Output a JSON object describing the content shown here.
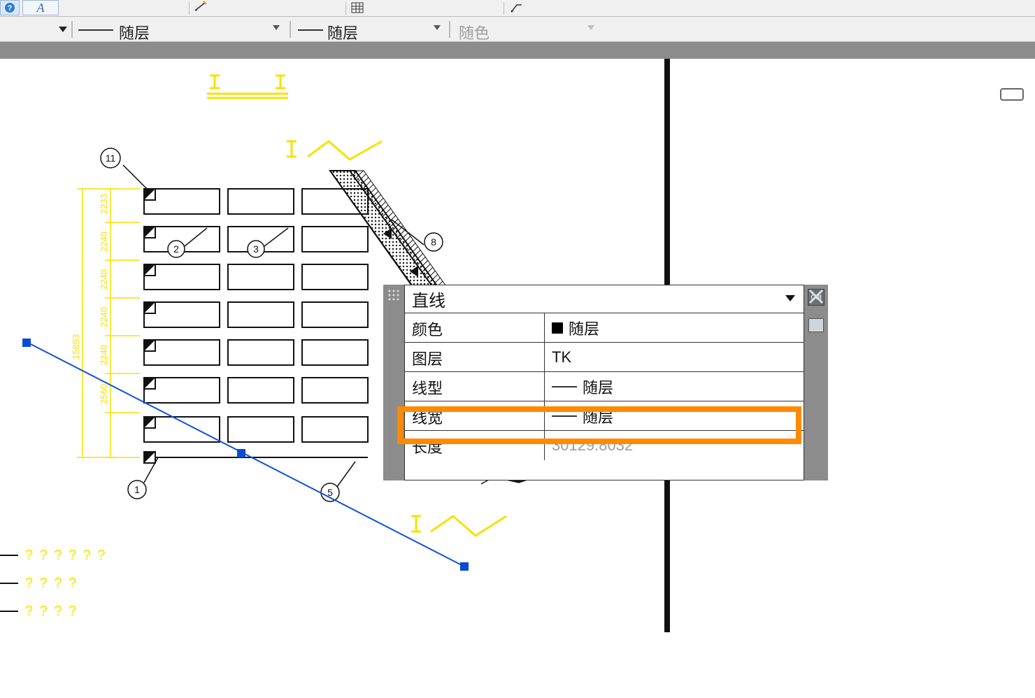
{
  "toolbar1": {
    "help_icon": "help-icon",
    "textstyle_glyph": "A"
  },
  "toolbar2": {
    "linetype_label": "随层",
    "lineweight_label": "随层",
    "color_label": "随色"
  },
  "properties_panel": {
    "object_type": "直线",
    "rows": {
      "color": {
        "key": "颜色",
        "value": "随层"
      },
      "layer": {
        "key": "图层",
        "value": "TK"
      },
      "linetype": {
        "key": "线型",
        "value": "随层"
      },
      "lineweight": {
        "key": "线宽",
        "value": "随层"
      },
      "length": {
        "key": "长度",
        "value": "30129.8032"
      }
    }
  },
  "drawing": {
    "bubble_labels": [
      "11",
      "2",
      "3",
      "8",
      "1",
      "5"
    ],
    "dim_texts": [
      "2233",
      "2240",
      "2240",
      "2240",
      "2240",
      "2560",
      "15893"
    ]
  },
  "legend": {
    "rows": [
      "? ? ? ? ? ?",
      "? ? ? ?",
      "? ? ? ?"
    ]
  }
}
